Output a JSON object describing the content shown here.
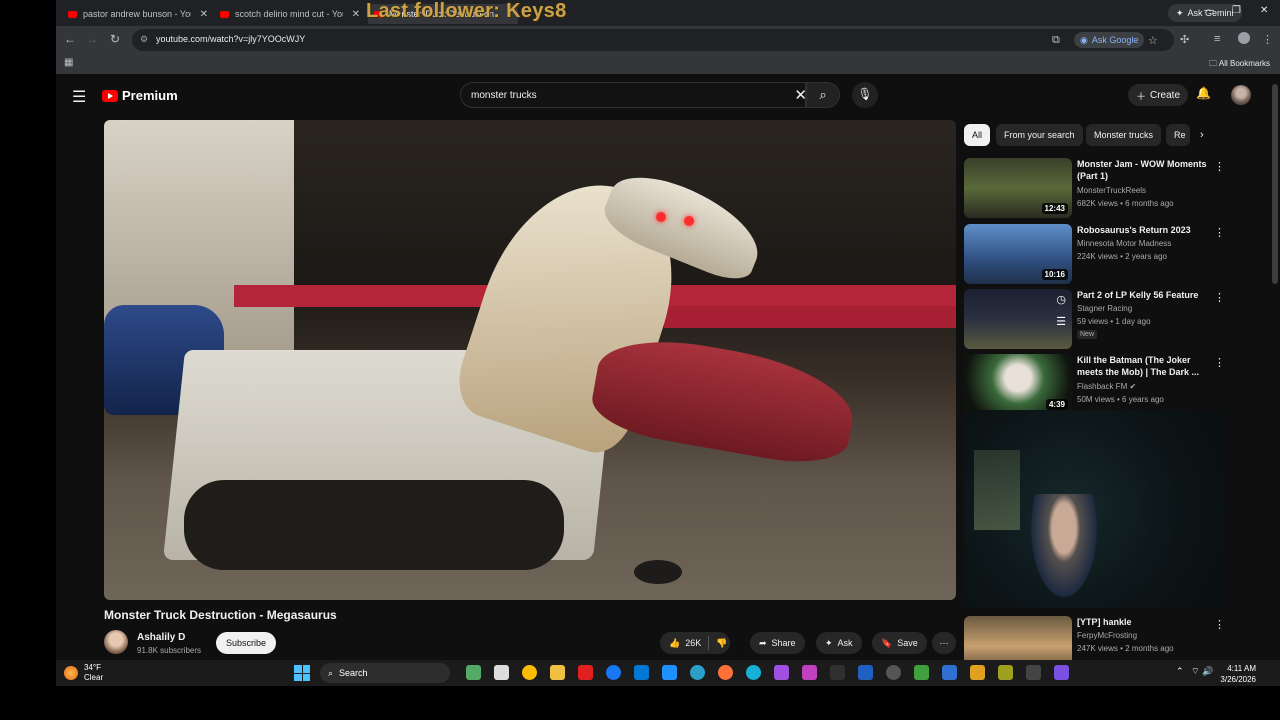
{
  "browser": {
    "tabs": [
      {
        "label": "pastor andrew bunson - YouTube"
      },
      {
        "label": "scotch delirio mind cut - YouTube"
      },
      {
        "label": "Monster Truck Destruction"
      }
    ],
    "overlay_text": "Last follower: Keys8",
    "ask_gemini": "Ask Gemini",
    "url": "youtube.com/watch?v=jly7YOOcWJY",
    "ask_google": "Ask Google",
    "all_bookmarks": "All Bookmarks"
  },
  "youtube": {
    "brand": "Premium",
    "search_query": "monster trucks",
    "create_label": "Create",
    "video": {
      "title": "Monster Truck Destruction - Megasaurus",
      "channel": "Ashalily D",
      "subscribers": "91.8K subscribers",
      "subscribe_label": "Subscribe",
      "likes": "26K",
      "share_label": "Share",
      "ask_label": "Ask",
      "save_label": "Save"
    },
    "chips": [
      {
        "label": "All",
        "active": true
      },
      {
        "label": "From your search",
        "active": false
      },
      {
        "label": "Monster trucks",
        "active": false
      },
      {
        "label": "Re",
        "active": false
      }
    ],
    "recommendations": [
      {
        "title": "Monster Jam - WOW Moments (Part 1)",
        "channel": "MonsterTruckReels",
        "meta": "682K views • 6 months ago",
        "duration": "12:43",
        "badge": ""
      },
      {
        "title": "Robosaurus's Return 2023",
        "channel": "Minnesota Motor Madness",
        "meta": "224K views • 2 years ago",
        "duration": "10:16",
        "badge": ""
      },
      {
        "title": "Part 2 of LP Kelly 56 Feature",
        "channel": "Stagner Racing",
        "meta": "59 views • 1 day ago",
        "duration": "",
        "badge": "New"
      },
      {
        "title": "Kill the Batman (The Joker meets the Mob) | The Dark ...",
        "channel": "Flashback FM",
        "meta": "50M views • 6 years ago",
        "duration": "4:39",
        "badge": ""
      },
      {
        "title": "[YTP] hankle",
        "channel": "FerpyMcFrosting",
        "meta": "247K views • 2 months ago",
        "duration": "",
        "badge": ""
      }
    ]
  },
  "taskbar": {
    "temperature": "34°F",
    "condition": "Clear",
    "search_label": "Search",
    "time": "4:11 AM",
    "date": "3/26/2026"
  }
}
